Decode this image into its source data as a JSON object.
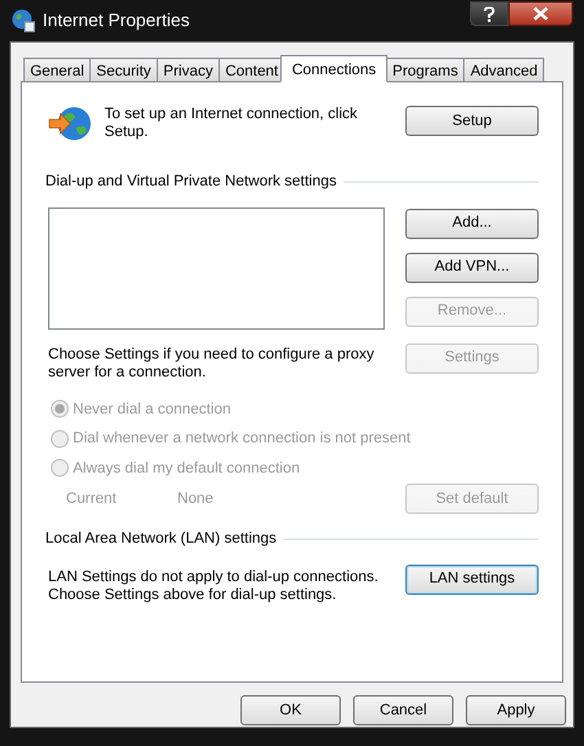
{
  "window": {
    "title": "Internet Properties"
  },
  "tabs": [
    {
      "label": "General",
      "selected": false
    },
    {
      "label": "Security",
      "selected": false
    },
    {
      "label": "Privacy",
      "selected": false
    },
    {
      "label": "Content",
      "selected": false
    },
    {
      "label": "Connections",
      "selected": true
    },
    {
      "label": "Programs",
      "selected": false
    },
    {
      "label": "Advanced",
      "selected": false
    }
  ],
  "setup": {
    "text": "To set up an Internet connection, click Setup.",
    "button": {
      "label": "Setup",
      "disabled": false
    }
  },
  "dialup": {
    "heading": "Dial-up and Virtual Private Network settings",
    "buttons": [
      {
        "label": "Add...",
        "disabled": false
      },
      {
        "label": "Add VPN...",
        "disabled": false
      },
      {
        "label": "Remove...",
        "disabled": true
      }
    ],
    "proxy_text": "Choose Settings if you need to configure a proxy server for a connection.",
    "settings_button": {
      "label": "Settings",
      "disabled": true
    },
    "options": [
      {
        "label": "Never dial a connection",
        "selected": true,
        "disabled": true
      },
      {
        "label": "Dial whenever a network connection is not present",
        "selected": false,
        "disabled": true
      },
      {
        "label": "Always dial my default connection",
        "selected": false,
        "disabled": true
      }
    ],
    "current_label": "Current",
    "current_value": "None",
    "set_default_button": {
      "label": "Set default",
      "disabled": true
    }
  },
  "lan": {
    "heading": "Local Area Network (LAN) settings",
    "text": "LAN Settings do not apply to dial-up connections. Choose Settings above for dial-up settings.",
    "button": {
      "label": "LAN settings",
      "disabled": false,
      "focused": true
    }
  },
  "footer_buttons": [
    {
      "label": "OK",
      "disabled": false
    },
    {
      "label": "Cancel",
      "disabled": false
    },
    {
      "label": "Apply",
      "disabled": false
    }
  ]
}
